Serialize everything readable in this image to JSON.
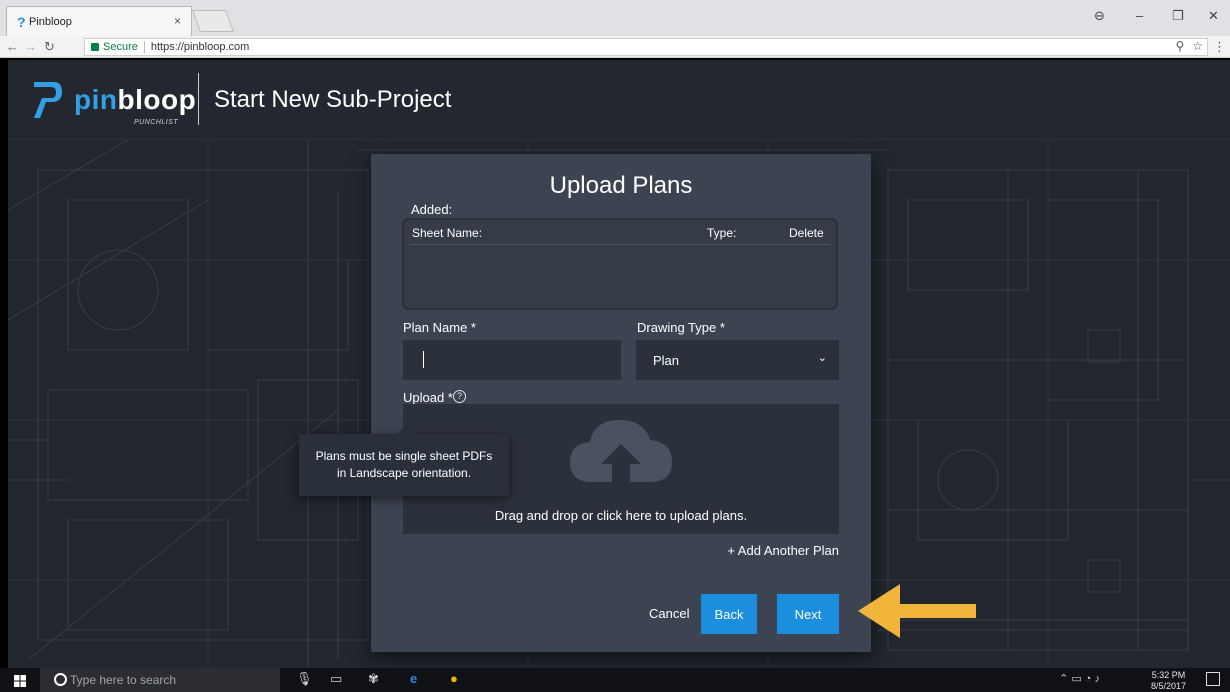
{
  "browser": {
    "tab_title": "Pinbloop",
    "tab_close": "×",
    "secure_label": "Secure",
    "url": "https://pinbloop.com"
  },
  "header": {
    "logo_pin": "pin",
    "logo_bloop": "bloop",
    "logo_sub": "PUNCHLIST",
    "title": "Start New Sub-Project"
  },
  "modal": {
    "title": "Upload Plans",
    "added_label": "Added:",
    "columns": [
      "Sheet Name:",
      "Type:",
      "Delete"
    ],
    "plan_name_label": "Plan Name *",
    "plan_name_value": "",
    "drawing_type_label": "Drawing Type *",
    "drawing_type_value": "Plan",
    "upload_label": "Upload *",
    "help_icon": "?",
    "drop_text": "Drag and drop or click here to upload plans.",
    "add_plan": "+ Add Another Plan",
    "cancel": "Cancel",
    "back": "Back",
    "next": "Next"
  },
  "tooltip": {
    "line1": "Plans must be single sheet PDFs",
    "line2": "in Landscape orientation."
  },
  "taskbar": {
    "search_placeholder": "Type here to search",
    "time": "5:32 PM",
    "date": "8/5/2017"
  },
  "colors": {
    "accent": "#1b8fdd",
    "logo_blue": "#33a0e6",
    "annotation_arrow": "#f2b53c",
    "modal_bg": "#3d4451"
  }
}
